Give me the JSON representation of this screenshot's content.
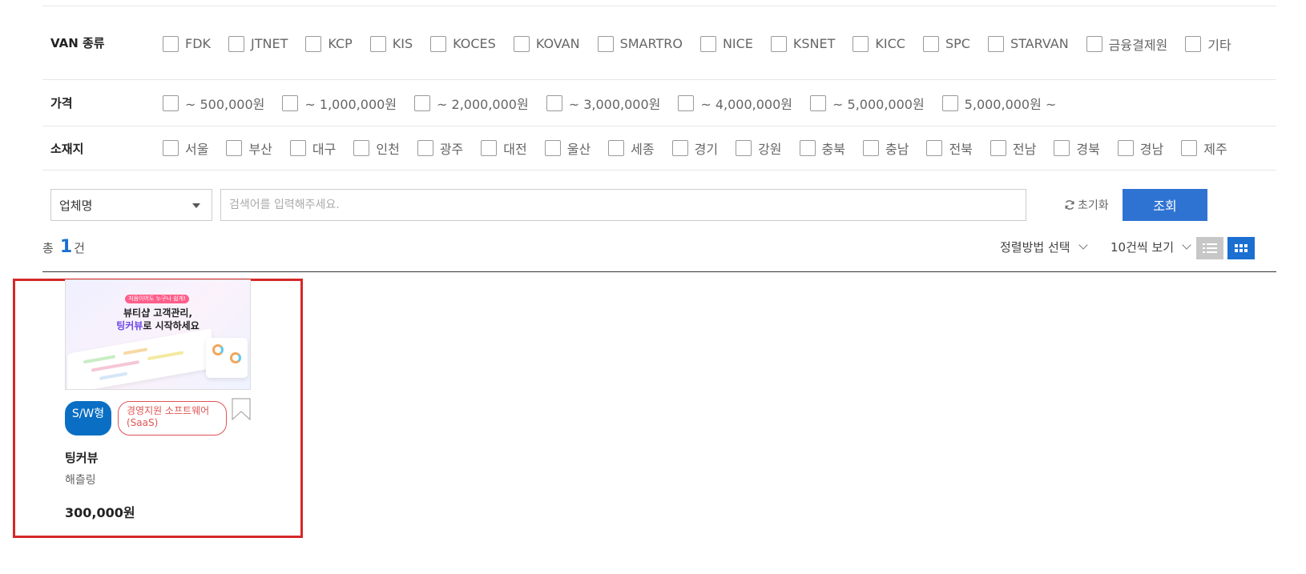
{
  "filters": {
    "van": {
      "label": "VAN 종류",
      "options": [
        "FDK",
        "JTNET",
        "KCP",
        "KIS",
        "KOCES",
        "KOVAN",
        "SMARTRO",
        "NICE",
        "KSNET",
        "KICC",
        "SPC",
        "STARVAN",
        "금융결제원",
        "기타"
      ]
    },
    "price": {
      "label": "가격",
      "options": [
        "~ 500,000원",
        "~ 1,000,000원",
        "~ 2,000,000원",
        "~ 3,000,000원",
        "~ 4,000,000원",
        "~ 5,000,000원",
        "5,000,000원 ~"
      ]
    },
    "location": {
      "label": "소재지",
      "options": [
        "서울",
        "부산",
        "대구",
        "인천",
        "광주",
        "대전",
        "울산",
        "세종",
        "경기",
        "강원",
        "충북",
        "충남",
        "전북",
        "전남",
        "경북",
        "경남",
        "제주"
      ]
    }
  },
  "search": {
    "field_selected": "업체명",
    "placeholder": "검색어를 입력해주세요.",
    "reset_label": "초기화",
    "submit_label": "조회"
  },
  "results": {
    "total_prefix": "총",
    "total_count": "1",
    "total_suffix": "건",
    "sort_label": "정렬방법 선택",
    "per_page_label": "10건씩 보기"
  },
  "colors": {
    "primary": "#2f73d2",
    "accent_blue": "#1b6fd1",
    "tag_blue": "#0a6fc4",
    "tag_red": "#e05454",
    "highlight_border": "#d62828"
  },
  "product": {
    "thumb_pill": "처음이어도 누구나 쉽게!",
    "thumb_line1": "뷰티샵 고객관리,",
    "thumb_line2_accent": "팅커뷰",
    "thumb_line2_rest": "로 시작하세요",
    "type_tag": "S/W형",
    "category_line1": "경영지원 소프트웨어",
    "category_line2": "(SaaS)",
    "name": "팅커뷰",
    "vendor": "해츨링",
    "price": "300,000원"
  }
}
